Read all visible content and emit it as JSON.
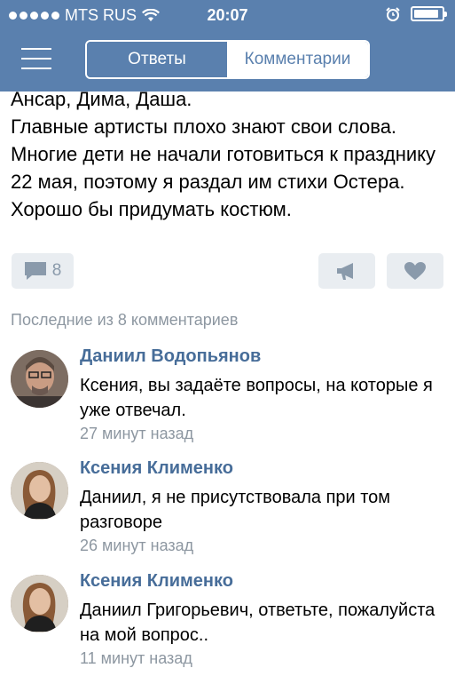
{
  "status_bar": {
    "carrier": "MTS RUS",
    "time": "20:07",
    "battery_level": 0.9
  },
  "header": {
    "menu_icon": "hamburger-icon",
    "tabs": [
      {
        "label": "Ответы",
        "selected": false
      },
      {
        "label": "Комментарии",
        "selected": true
      }
    ]
  },
  "post": {
    "text": "Ансар, Дима, Даша.\nГлавные артисты плохо знают свои слова. Многие дети не начали готовиться к празднику 22 мая, поэтому я раздал им стихи Остера. Хорошо бы придумать костюм.",
    "comments_count": "8",
    "comment_icon": "comment-bubble-icon",
    "share_icon": "megaphone-icon",
    "like_icon": "heart-icon"
  },
  "comments_section": {
    "title": "Последние из 8 комментариев",
    "items": [
      {
        "author": "Даниил Водопьянов",
        "text": "Ксения, вы задаёте вопросы, на которые я уже отвечал.",
        "time": "27 минут назад"
      },
      {
        "author": "Ксения Клименко",
        "text": "Даниил, я не присутствовала при том разговоре",
        "time": "26 минут назад"
      },
      {
        "author": "Ксения Клименко",
        "text": "Даниил Григорьевич, ответьте, пожалуйста на мой вопрос..",
        "time": "11 минут назад"
      }
    ]
  },
  "colors": {
    "header_bg": "#5a80ae",
    "author": "#476d99",
    "muted": "#8d97a1",
    "button_bg": "#e9edf1"
  }
}
